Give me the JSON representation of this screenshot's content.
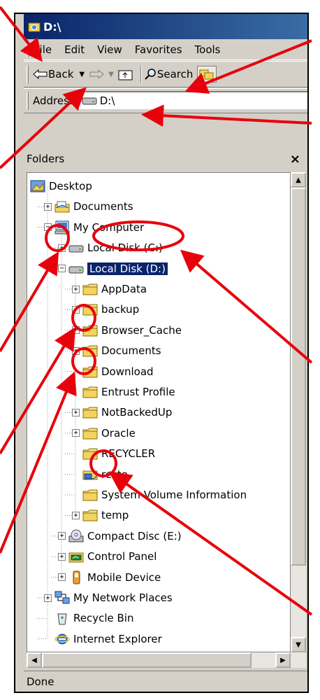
{
  "window": {
    "title": "D:\\"
  },
  "menu": [
    "File",
    "Edit",
    "View",
    "Favorites",
    "Tools"
  ],
  "toolbar": {
    "back_label": "Back",
    "search_label": "Search"
  },
  "address": {
    "label": "Address",
    "value": "D:\\"
  },
  "folders_pane": {
    "title": "Folders",
    "close": "×"
  },
  "tree": [
    {
      "label": "Desktop",
      "icon": "desktop-icon",
      "indent": 0,
      "expander": "none"
    },
    {
      "label": "Documents",
      "icon": "documents-folder-icon",
      "indent": 1,
      "expander": "plus"
    },
    {
      "label": "My Computer",
      "icon": "computer-icon",
      "indent": 1,
      "expander": "minus"
    },
    {
      "label": "Local Disk (C:)",
      "icon": "drive-icon",
      "indent": 2,
      "expander": "plus"
    },
    {
      "label": "Local Disk (D:)",
      "icon": "drive-icon",
      "indent": 2,
      "expander": "minus",
      "selected": true
    },
    {
      "label": "AppData",
      "icon": "folder-icon",
      "indent": 3,
      "expander": "plus"
    },
    {
      "label": "backup",
      "icon": "folder-icon",
      "indent": 3,
      "expander": "plus"
    },
    {
      "label": "Browser_Cache",
      "icon": "folder-icon",
      "indent": 3,
      "expander": "plus"
    },
    {
      "label": "Documents",
      "icon": "folder-icon",
      "indent": 3,
      "expander": "plus"
    },
    {
      "label": "Download",
      "icon": "folder-icon",
      "indent": 3,
      "expander": "none"
    },
    {
      "label": "Entrust Profile",
      "icon": "folder-icon",
      "indent": 3,
      "expander": "none"
    },
    {
      "label": "NotBackedUp",
      "icon": "folder-icon",
      "indent": 3,
      "expander": "plus"
    },
    {
      "label": "Oracle",
      "icon": "folder-icon",
      "indent": 3,
      "expander": "plus"
    },
    {
      "label": "RECYCLER",
      "icon": "folder-icon",
      "indent": 3,
      "expander": "none"
    },
    {
      "label": "resto",
      "icon": "shared-folder-icon",
      "indent": 3,
      "expander": "none"
    },
    {
      "label": "System Volume Information",
      "icon": "folder-icon",
      "indent": 3,
      "expander": "none"
    },
    {
      "label": "temp",
      "icon": "folder-icon",
      "indent": 3,
      "expander": "plus"
    },
    {
      "label": "Compact Disc (E:)",
      "icon": "cd-icon",
      "indent": 2,
      "expander": "plus"
    },
    {
      "label": "Control Panel",
      "icon": "control-panel-icon",
      "indent": 2,
      "expander": "plus"
    },
    {
      "label": "Mobile Device",
      "icon": "mobile-device-icon",
      "indent": 2,
      "expander": "plus"
    },
    {
      "label": "My Network Places",
      "icon": "network-icon",
      "indent": 1,
      "expander": "plus"
    },
    {
      "label": "Recycle Bin",
      "icon": "recycle-bin-icon",
      "indent": 1,
      "expander": "none"
    },
    {
      "label": "Internet Explorer",
      "icon": "ie-icon",
      "indent": 1,
      "expander": "none"
    }
  ],
  "status": {
    "text": "Done"
  },
  "colors": {
    "annotation": "#e8000b",
    "selection": "#0a246a",
    "chrome": "#d4d0c8"
  }
}
